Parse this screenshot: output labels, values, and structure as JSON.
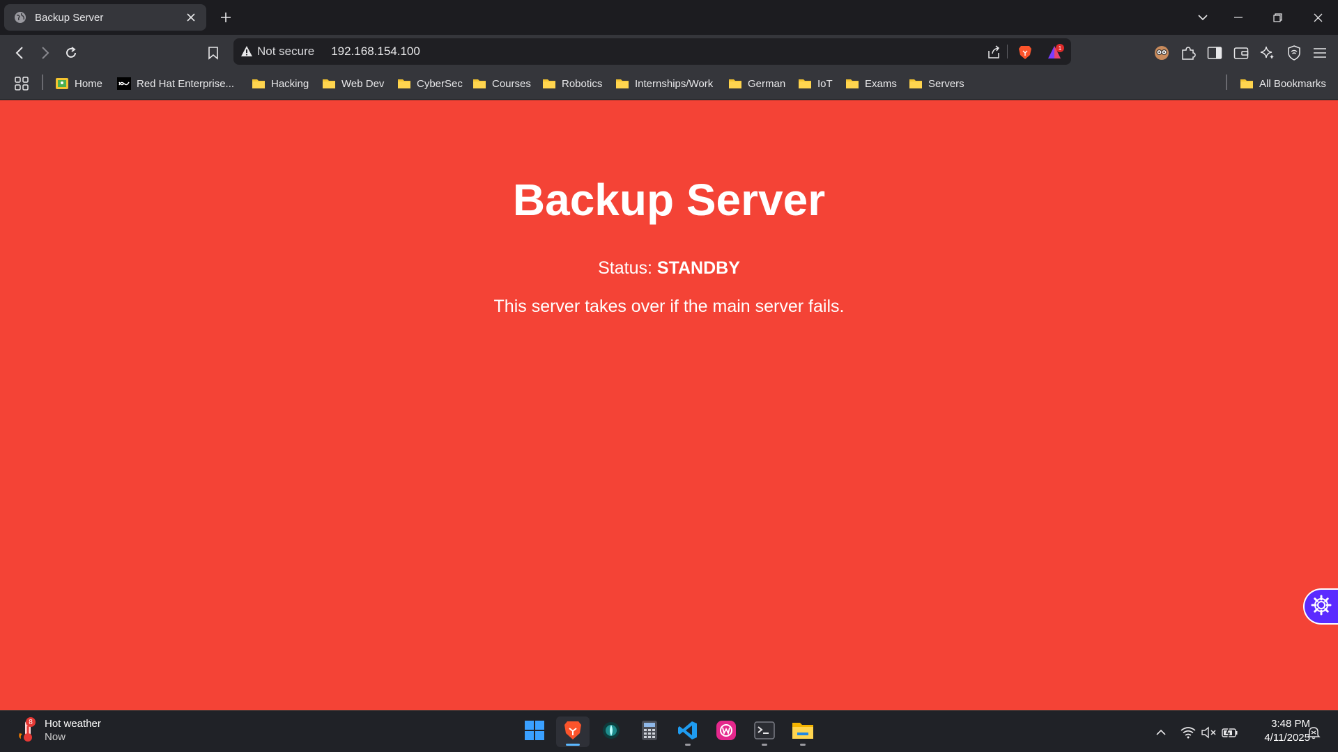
{
  "browser": {
    "tab": {
      "title": "Backup Server"
    },
    "address": {
      "security_label": "Not secure",
      "url": "192.168.154.100"
    },
    "notification_count": "1",
    "bookmarks": [
      {
        "label": "Home",
        "icon": "home-bookmark-icon"
      },
      {
        "label": "Red Hat Enterprise...",
        "icon": "redhat-bookmark-icon"
      },
      {
        "label": "Hacking",
        "icon": "folder-icon"
      },
      {
        "label": "Web Dev",
        "icon": "folder-icon"
      },
      {
        "label": "CyberSec",
        "icon": "folder-icon"
      },
      {
        "label": "Courses",
        "icon": "folder-icon"
      },
      {
        "label": "Robotics",
        "icon": "folder-icon"
      },
      {
        "label": "Internships/Work",
        "icon": "folder-icon"
      },
      {
        "label": "German",
        "icon": "folder-icon"
      },
      {
        "label": "IoT",
        "icon": "folder-icon"
      },
      {
        "label": "Exams",
        "icon": "folder-icon"
      },
      {
        "label": "Servers",
        "icon": "folder-icon"
      }
    ],
    "all_bookmarks_label": "All Bookmarks"
  },
  "page": {
    "heading": "Backup Server",
    "status_prefix": "Status:",
    "status_value": "STANDBY",
    "description": "This server takes over if the main server fails.",
    "background_color": "#f44336"
  },
  "taskbar": {
    "weather": {
      "title": "Hot weather",
      "subtitle": "Now",
      "badge": "8"
    },
    "apps": [
      "start-menu",
      "brave-browser",
      "app-eye",
      "calculator",
      "vscode",
      "wampserver",
      "terminal",
      "file-explorer"
    ],
    "clock": {
      "time": "3:48 PM",
      "date": "4/11/2025"
    }
  }
}
